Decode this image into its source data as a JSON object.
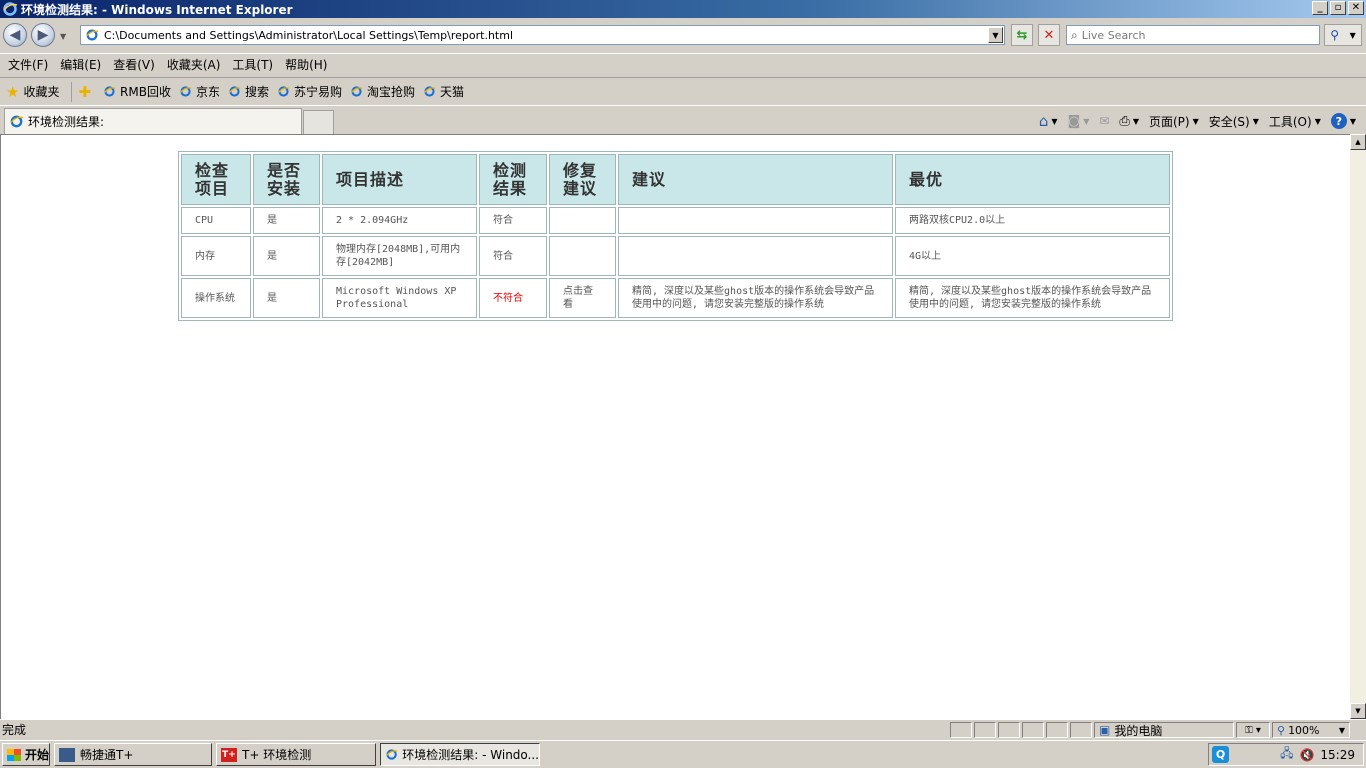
{
  "window": {
    "title": "环境检测结果: - Windows Internet Explorer",
    "btn_min": "_",
    "btn_max": "▫",
    "btn_close": "✕"
  },
  "address": {
    "url": "C:\\Documents and Settings\\Administrator\\Local Settings\\Temp\\report.html",
    "search_placeholder": "Live Search"
  },
  "menu": [
    "文件(F)",
    "编辑(E)",
    "查看(V)",
    "收藏夹(A)",
    "工具(T)",
    "帮助(H)"
  ],
  "favorites": {
    "label": "收藏夹",
    "items": [
      "RMB回收",
      "京东",
      "搜索",
      "苏宁易购",
      "淘宝抢购",
      "天猫"
    ]
  },
  "tab": {
    "title": "环境检测结果:"
  },
  "commands": {
    "page": "页面(P)",
    "safety": "安全(S)",
    "tools": "工具(O)",
    "help": "?"
  },
  "report": {
    "headers": [
      [
        "检查",
        "项目"
      ],
      [
        "是否",
        "安装"
      ],
      [
        "项目描述"
      ],
      [
        "检测",
        "结果"
      ],
      [
        "修复",
        "建议"
      ],
      [
        "建议"
      ],
      [
        "最优"
      ]
    ],
    "rows": [
      {
        "item": "CPU",
        "installed": "是",
        "description": "2 * 2.094GHz",
        "result": "符合",
        "result_status": "ok",
        "fix": "",
        "suggestion": "",
        "best": "两路双核CPU2.0以上"
      },
      {
        "item": "内存",
        "installed": "是",
        "description": "物理内存[2048MB],可用内存[2042MB]",
        "result": "符合",
        "result_status": "ok",
        "fix": "",
        "suggestion": "",
        "best": "4G以上"
      },
      {
        "item": "操作系统",
        "installed": "是",
        "description": "Microsoft Windows XP Professional",
        "result": "不符合",
        "result_status": "fail",
        "fix": "点击查看",
        "suggestion": "精简, 深度以及某些ghost版本的操作系统会导致产品使用中的问题, 请您安装完整版的操作系统",
        "best": "精简, 深度以及某些ghost版本的操作系统会导致产品使用中的问题, 请您安装完整版的操作系统"
      }
    ],
    "colors": {
      "header_bg": "#c9e7e9",
      "border": "#9db7bd",
      "fail_text": "#e00000"
    }
  },
  "status": {
    "text": "完成",
    "zone": "我的电脑",
    "zoom": "100%"
  },
  "taskbar": {
    "start": "开始",
    "buttons": [
      "畅捷通T+",
      "T+ 环境检测",
      "环境检测结果: - Windo..."
    ],
    "clock": "15:29"
  }
}
